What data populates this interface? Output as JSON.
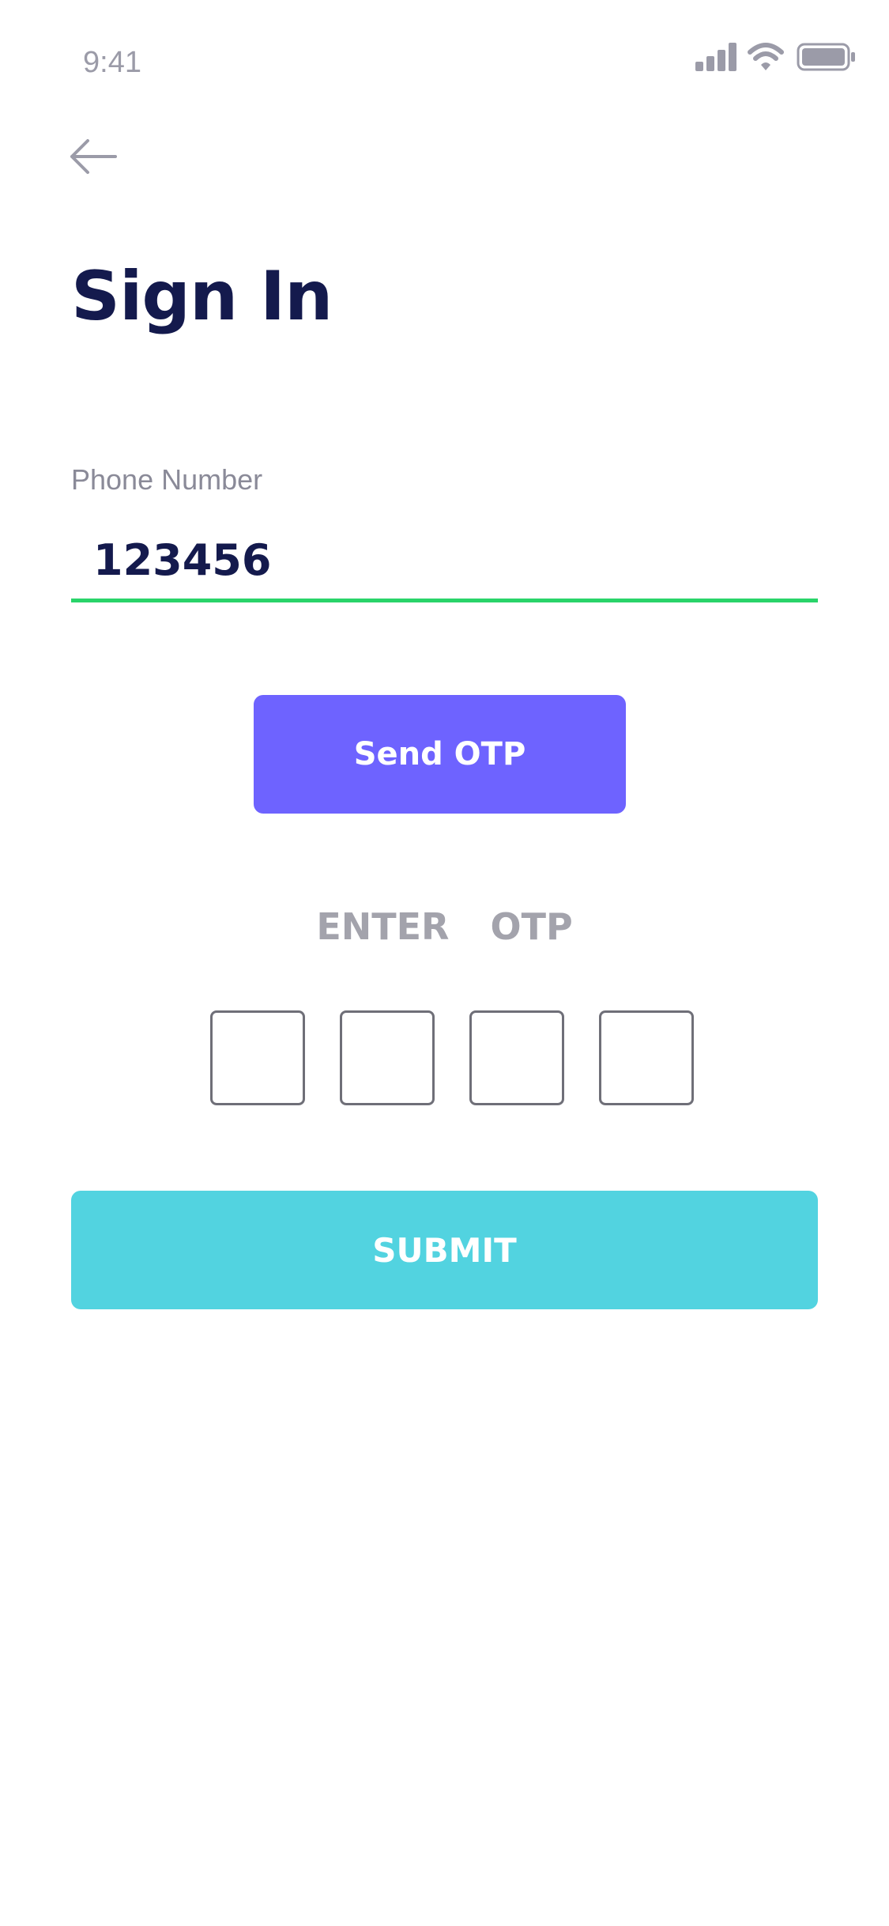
{
  "status_bar": {
    "time": "9:41",
    "icons": [
      "cellular-signal-icon",
      "wifi-icon",
      "battery-icon"
    ]
  },
  "header": {
    "back_icon": "arrow-left-icon",
    "title": "Sign In"
  },
  "form": {
    "phone_label": "Phone Number",
    "phone_value": "123456",
    "send_otp_label": "Send OTP",
    "otp_label": "ENTER  OTP",
    "otp_digits": [
      "",
      "",
      "",
      ""
    ],
    "submit_label": "SUBMIT"
  },
  "colors": {
    "title": "#141a4d",
    "field_underline_active": "#29d46a",
    "send_otp_button": "#6e63ff",
    "submit_button": "#52d3e0",
    "muted_text": "#9b9ba8"
  }
}
